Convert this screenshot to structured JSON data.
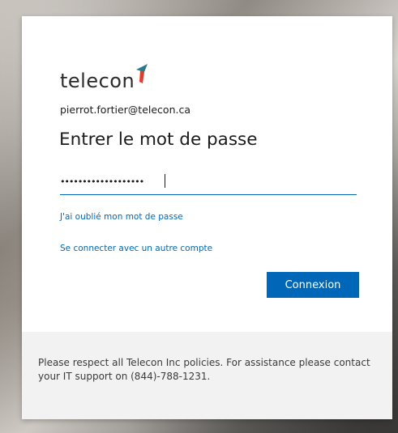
{
  "brand": {
    "name": "telecon",
    "logo_colors": [
      "#2b7a8c",
      "#e33b2e"
    ]
  },
  "login": {
    "email": "pierrot.fortier@telecon.ca",
    "title": "Entrer le mot de passe",
    "password_masked": "•••••••••••••••••••",
    "forgot_link": "J'ai oublié mon mot de passe",
    "other_account_link": "Se connecter avec un autre compte",
    "submit_label": "Connexion"
  },
  "footer": {
    "notice": "Please respect all Telecon Inc policies. For assistance please contact your IT support on (844)-788-1231."
  },
  "colors": {
    "accent": "#0067b8",
    "footer_bg": "#f2f2f2"
  }
}
